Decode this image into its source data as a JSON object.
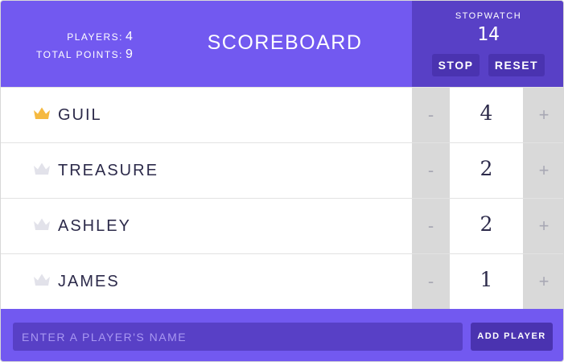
{
  "stats": {
    "players_label": "PLAYERS:",
    "players_value": "4",
    "points_label": "TOTAL POINTS:",
    "points_value": "9"
  },
  "title": "SCOREBOARD",
  "stopwatch": {
    "label": "STOPWATCH",
    "time": "14",
    "stop_label": "STOP",
    "reset_label": "RESET"
  },
  "players": [
    {
      "name": "GUIL",
      "score": "4",
      "leader": true
    },
    {
      "name": "TREASURE",
      "score": "2",
      "leader": false
    },
    {
      "name": "ASHLEY",
      "score": "2",
      "leader": false
    },
    {
      "name": "JAMES",
      "score": "1",
      "leader": false
    }
  ],
  "counter": {
    "decrement_label": "-",
    "increment_label": "+"
  },
  "add_form": {
    "placeholder": "ENTER A PLAYER'S NAME",
    "value": "",
    "button_label": "ADD PLAYER"
  },
  "colors": {
    "header_bg": "#7259f0",
    "stopwatch_bg": "#5840c6",
    "button_bg": "#4a33b0",
    "crown_leader": "#f5b940",
    "crown_default": "#e2e2ea",
    "counter_bg": "#d9d9d9"
  },
  "icons": {
    "crown": "crown-icon"
  }
}
